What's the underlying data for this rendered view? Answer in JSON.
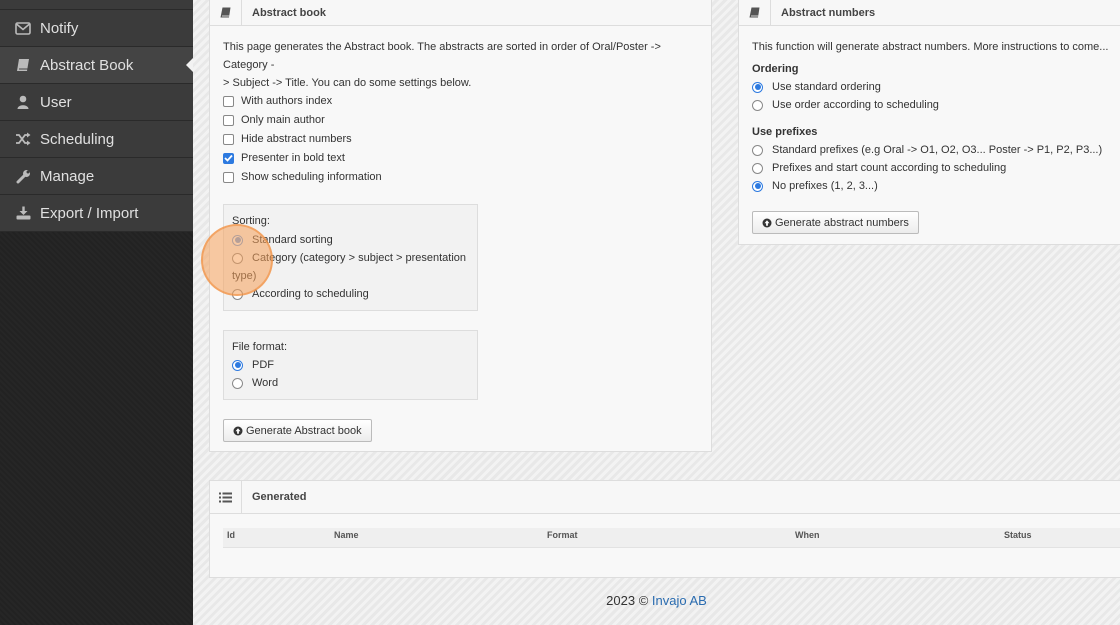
{
  "sidebar": {
    "items": [
      {
        "label": "Notify",
        "icon": "envelope-icon",
        "active": false
      },
      {
        "label": "Abstract Book",
        "icon": "book-icon",
        "active": true
      },
      {
        "label": "User",
        "icon": "user-icon",
        "active": false
      },
      {
        "label": "Scheduling",
        "icon": "shuffle-icon",
        "active": false
      },
      {
        "label": "Manage",
        "icon": "wrench-icon",
        "active": false
      },
      {
        "label": "Export / Import",
        "icon": "download-icon",
        "active": false
      }
    ]
  },
  "abstract_book": {
    "title": "Abstract book",
    "description_line1": "This page generates the Abstract book. The abstracts are sorted in order of Oral/Poster -> Category -",
    "description_line2": "> Subject -> Title. You can do some settings below.",
    "options": [
      {
        "label": "With authors index",
        "checked": false
      },
      {
        "label": "Only main author",
        "checked": false
      },
      {
        "label": "Hide abstract numbers",
        "checked": false
      },
      {
        "label": "Presenter in bold text",
        "checked": true
      },
      {
        "label": "Show scheduling information",
        "checked": false
      }
    ],
    "sorting_label": "Sorting:",
    "sorting_options": {
      "standard": "Standard sorting",
      "category_line1": "Category (category > subject > presentation",
      "category_line2": "type)",
      "scheduling": "According to scheduling"
    },
    "file_format_label": "File format:",
    "file_formats": [
      "PDF",
      "Word"
    ],
    "generate_button": "Generate Abstract book"
  },
  "abstract_numbers": {
    "title": "Abstract numbers",
    "description": "This function will generate abstract numbers. More instructions to come...",
    "ordering_label": "Ordering",
    "ordering_options": [
      "Use standard ordering",
      "Use order according to scheduling"
    ],
    "prefixes_label": "Use prefixes",
    "prefix_options": [
      "Standard prefixes (e.g Oral -> O1, O2, O3... Poster -> P1, P2, P3...)",
      "Prefixes and start count according to scheduling",
      "No prefixes (1, 2, 3...)"
    ],
    "generate_button": "Generate abstract numbers"
  },
  "generated": {
    "title": "Generated",
    "columns": [
      "Id",
      "Name",
      "Format",
      "When",
      "Status"
    ]
  },
  "footer": {
    "text": "2023 ©",
    "link": "Invajo AB"
  },
  "colors": {
    "accent": "#2d7ae0",
    "sidebar_bg": "#232323",
    "link": "#2a6cb0"
  }
}
